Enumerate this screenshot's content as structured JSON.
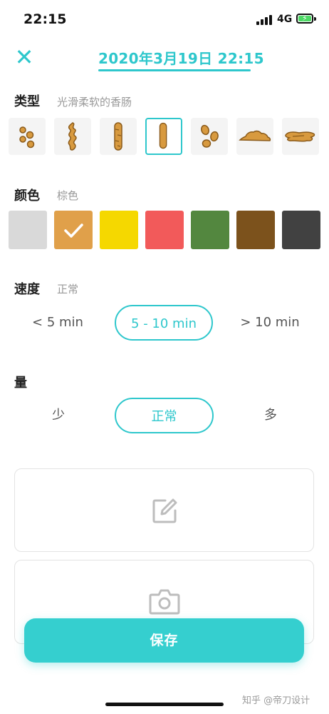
{
  "status_bar": {
    "time": "22:15",
    "network": "4G",
    "battery": {
      "charging": true,
      "level_fraction": 0.9
    }
  },
  "header": {
    "close_icon": "close-icon",
    "datetime": "2020年3月19日 22:15"
  },
  "type_section": {
    "title": "类型",
    "value": "光滑柔软的香肠",
    "options": [
      {
        "icon": "separate-hard-lumps-icon"
      },
      {
        "icon": "lumpy-sausage-icon"
      },
      {
        "icon": "cracked-sausage-icon"
      },
      {
        "icon": "smooth-soft-sausage-icon",
        "selected": true
      },
      {
        "icon": "soft-blobs-icon"
      },
      {
        "icon": "mushy-pieces-icon"
      },
      {
        "icon": "watery-icon"
      }
    ]
  },
  "color_section": {
    "title": "颜色",
    "value": "棕色",
    "swatches": [
      {
        "color": "#d9d9d9"
      },
      {
        "color": "#e0a04a",
        "selected": true
      },
      {
        "color": "#f5d800"
      },
      {
        "color": "#f25a5a"
      },
      {
        "color": "#53873f"
      },
      {
        "color": "#7c521c"
      },
      {
        "color": "#414141"
      }
    ]
  },
  "speed_section": {
    "title": "速度",
    "value": "正常",
    "options": [
      {
        "label": "< 5 min"
      },
      {
        "label": "5 - 10 min",
        "selected": true
      },
      {
        "label": "> 10 min"
      }
    ]
  },
  "amount_section": {
    "title": "量",
    "options": [
      {
        "label": "少"
      },
      {
        "label": "正常",
        "selected": true
      },
      {
        "label": "多"
      }
    ]
  },
  "note_card": {
    "icon": "edit-note-icon"
  },
  "photo_card": {
    "icon": "camera-icon"
  },
  "save_label": "保存",
  "watermark": "知乎 @帝刀设计",
  "colors": {
    "accent": "#2ec7cc",
    "save_button": "#35cfcf",
    "stool": "#d89a3f",
    "stool_outline": "#8a5a1a"
  }
}
